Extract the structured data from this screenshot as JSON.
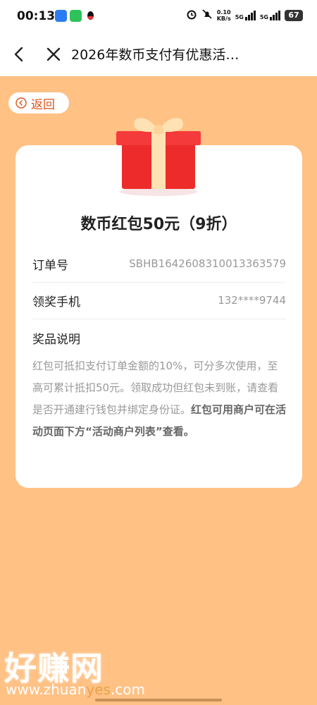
{
  "status_bar": {
    "time": "00:13",
    "net_speed_value": "0.10",
    "net_speed_unit": "KB/s",
    "sim1": "5G",
    "sim2": "5G",
    "battery": "67"
  },
  "nav": {
    "title": "2026年数币支付有优惠活…"
  },
  "return_label": "返回",
  "card": {
    "prize_title": "数币红包50元（9折）",
    "rows": [
      {
        "label": "订单号",
        "value": "SBHB1642608310013363579"
      },
      {
        "label": "领奖手机",
        "value": "132****9744"
      }
    ],
    "description_title": "奖品说明",
    "description_normal": "红包可抵扣支付订单金额的10%，可分多次使用，至高可累计抵扣50元。领取成功但红包未到账，请查看是否开通建行钱包并绑定身份证。",
    "description_bold": "红包可用商户可在活动页面下方“活动商户列表”查看。"
  },
  "watermark": {
    "logo_text": "好赚网",
    "url_part1": "www.zhuan",
    "url_part2": "yes",
    "url_part3": ".com"
  },
  "colors": {
    "background": "#ffc184",
    "accent": "#e0531c",
    "gift_red": "#ee2b2b",
    "ribbon": "#ffe2b3"
  }
}
